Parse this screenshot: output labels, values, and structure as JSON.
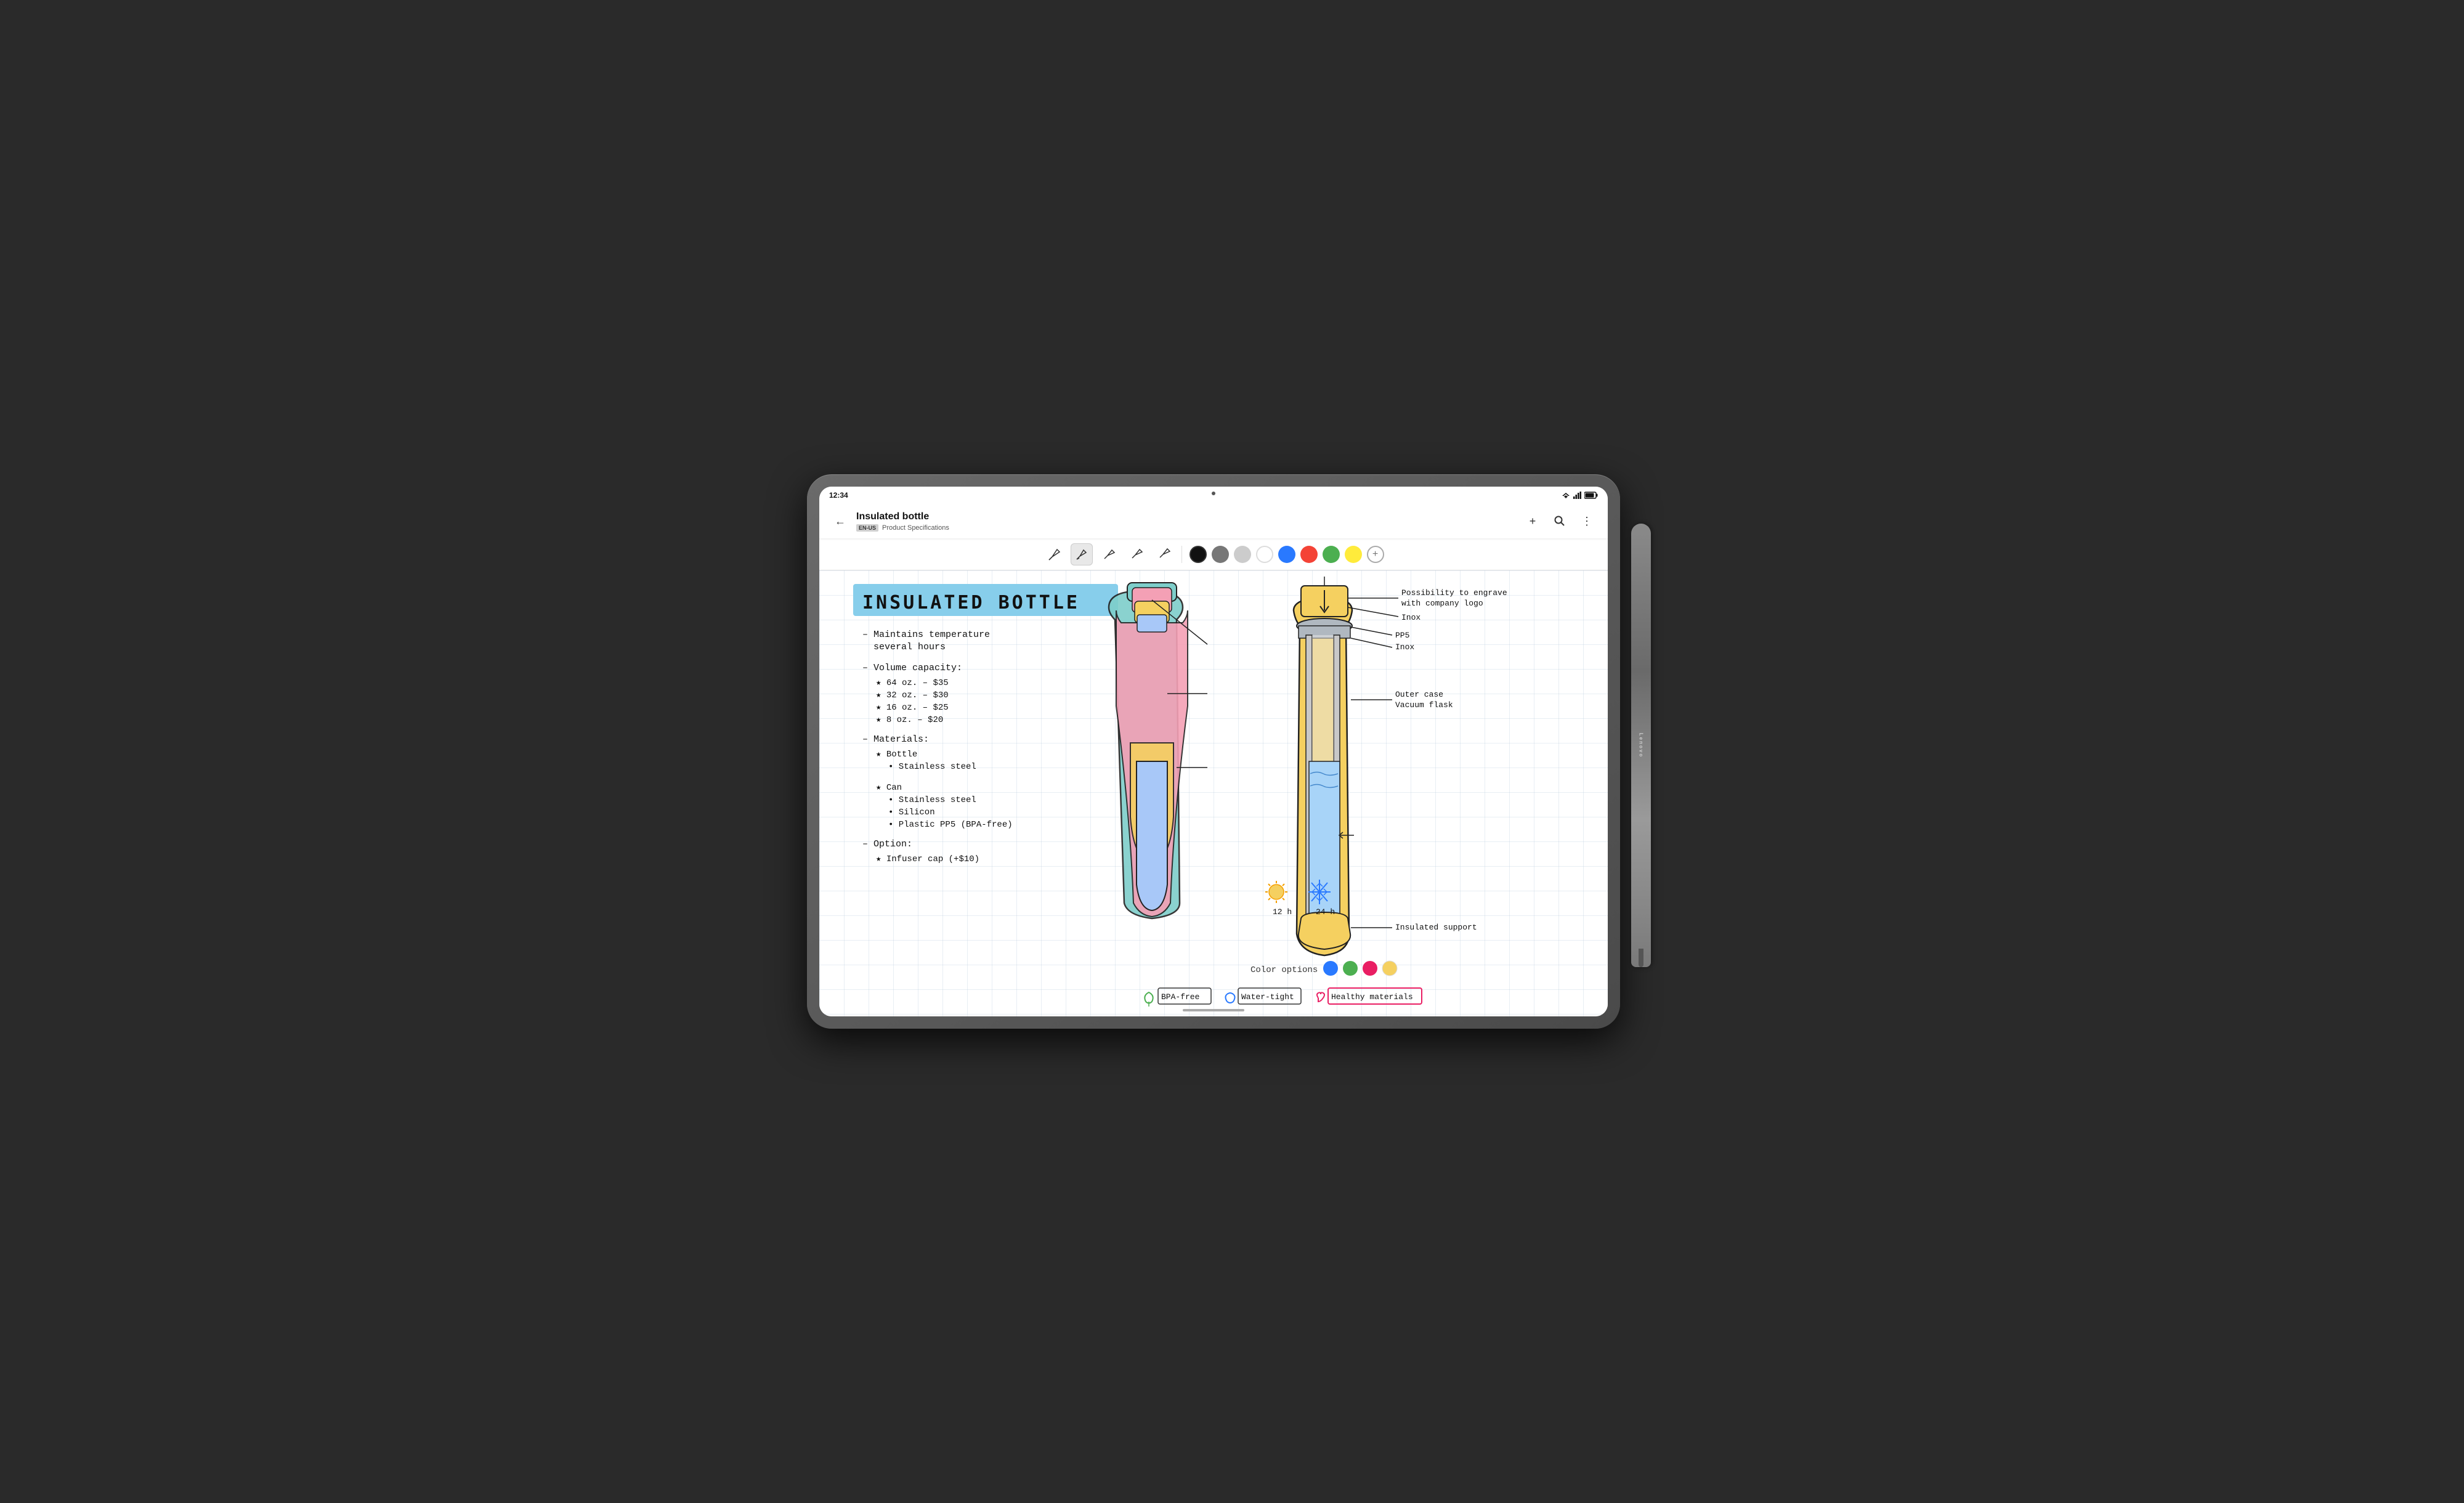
{
  "device": {
    "status_bar": {
      "time": "12:34"
    }
  },
  "app_bar": {
    "title": "Insulated bottle",
    "lang_badge": "EN-US",
    "subtitle": "Product Specifications",
    "back_label": "←",
    "add_label": "+",
    "search_label": "🔍",
    "more_label": "⋮"
  },
  "toolbar": {
    "pen_tools": [
      "✒",
      "✒",
      "✒",
      "✒",
      "✒"
    ],
    "colors": [
      {
        "color": "#111111",
        "active": true
      },
      {
        "color": "#777777",
        "active": false
      },
      {
        "color": "#cccccc",
        "active": false
      },
      {
        "color": "#ffffff",
        "active": false
      },
      {
        "color": "#2979ff",
        "active": false
      },
      {
        "color": "#f44336",
        "active": false
      },
      {
        "color": "#4caf50",
        "active": false
      },
      {
        "color": "#ffeb3b",
        "active": false
      }
    ]
  },
  "note": {
    "title": "INSULATED BOTTLE",
    "bullet1": "– Maintains temperature",
    "bullet1b": "  several hours",
    "bullet2": "– Volume capacity:",
    "vol1": "  ★ 64 oz. – $35",
    "vol2": "  ★ 32 oz. – $30",
    "vol3": "  ★ 16 oz. – $25",
    "vol4": "  ★  8 oz. – $20",
    "bullet3": "– Materials:",
    "mat1": "  ★ Bottle",
    "mat1a": "    • Stainless steel",
    "mat2": "  ★ Can",
    "mat2a": "    • Stainless steel",
    "mat2b": "    • Silicon",
    "mat2c": "    • Plastic PP5 (BPA-free)",
    "bullet4": "– Option:",
    "opt1": "  ★ Infuser cap (+$10)"
  },
  "diagram": {
    "label_engrave": "Possibility to engrave\nwith company logo",
    "label_inox1": "Inox",
    "label_pp5": "PP5",
    "label_inox2": "Inox",
    "label_outer": "Outer case\nVacuum flask",
    "label_insulated": "Insulated support",
    "label_12h": "12 h",
    "label_24h": "24 h"
  },
  "color_options": {
    "label": "Color options",
    "colors": [
      "#2979ff",
      "#4caf50",
      "#e91e63",
      "#ffeb3b"
    ]
  },
  "badges": [
    {
      "icon": "leaf",
      "label": "BPA-free"
    },
    {
      "icon": "water",
      "label": "Water-tight"
    },
    {
      "icon": "heart",
      "label": "Healthy materials"
    }
  ]
}
